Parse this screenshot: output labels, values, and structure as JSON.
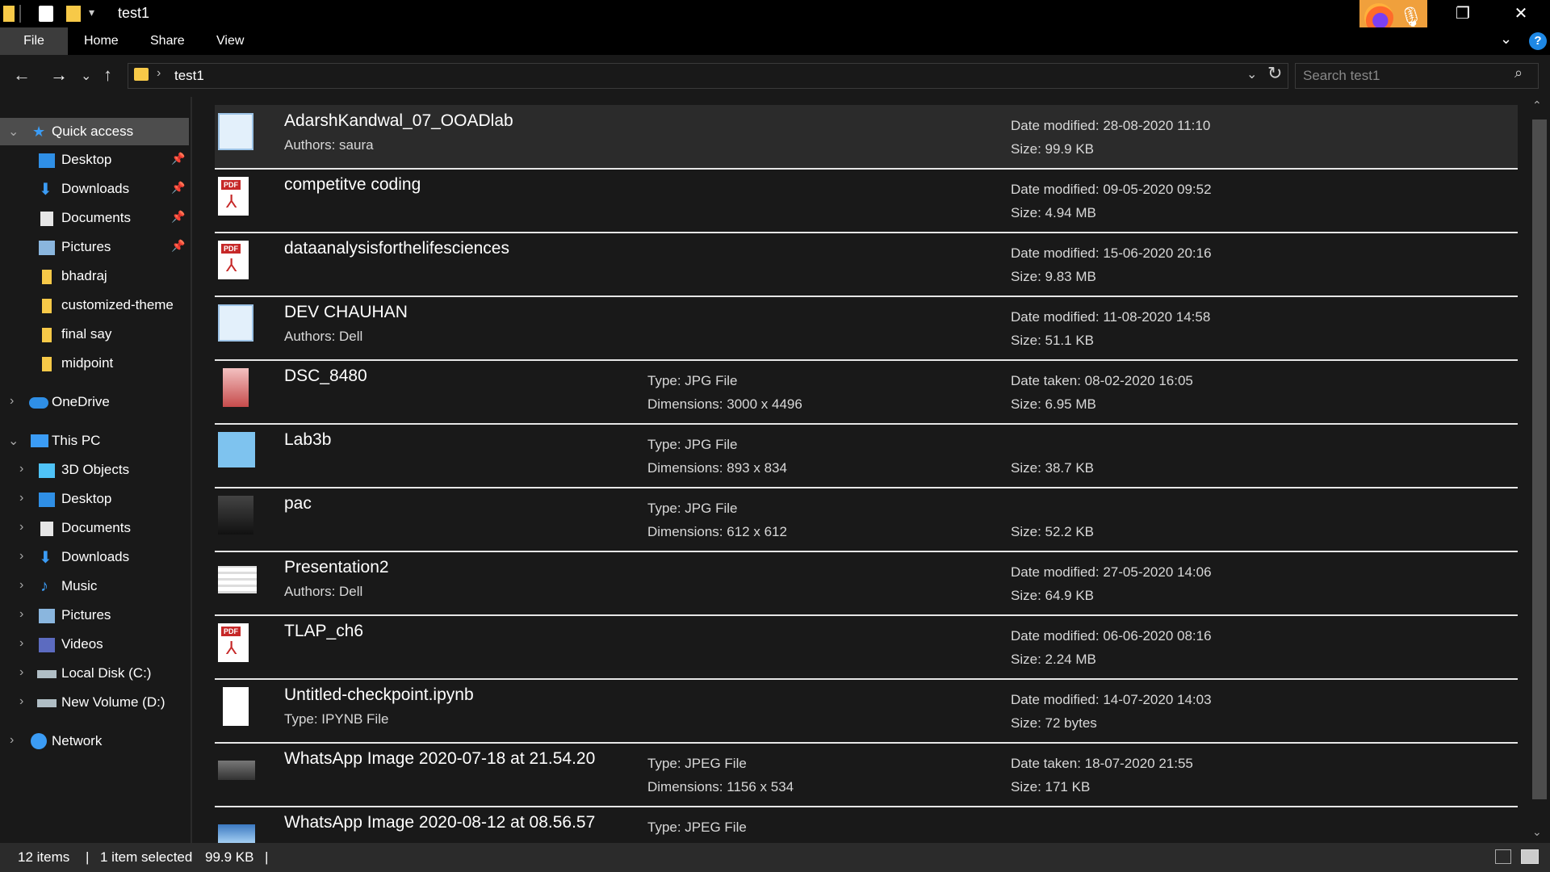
{
  "window": {
    "title": "test1"
  },
  "ribbon": {
    "tabs": [
      "File",
      "Home",
      "Share",
      "View"
    ]
  },
  "address": {
    "path": "test1",
    "search_placeholder": "Search test1"
  },
  "sidebar": {
    "quick_access": "Quick access",
    "quick_items": [
      "Desktop",
      "Downloads",
      "Documents",
      "Pictures",
      "bhadraj",
      "customized-theme",
      "final say",
      "midpoint"
    ],
    "onedrive": "OneDrive",
    "this_pc": "This PC",
    "pc_items": [
      "3D Objects",
      "Desktop",
      "Documents",
      "Downloads",
      "Music",
      "Pictures",
      "Videos",
      "Local Disk (C:)",
      "New Volume (D:)"
    ],
    "network": "Network"
  },
  "files": [
    {
      "name": "AdarshKandwal_07_OOADlab",
      "sub": "Authors: saura",
      "c2a": "",
      "c2b": "",
      "c3a": "Date modified: 28-08-2020 11:10",
      "c3b": "Size: 99.9 KB",
      "icon": "word-doc-icon"
    },
    {
      "name": "competitve coding",
      "sub": "",
      "c2a": "",
      "c2b": "",
      "c3a": "Date modified: 09-05-2020 09:52",
      "c3b": "Size: 4.94 MB",
      "icon": "pdf-icon"
    },
    {
      "name": "dataanalysisforthelifesciences",
      "sub": "",
      "c2a": "",
      "c2b": "",
      "c3a": "Date modified: 15-06-2020 20:16",
      "c3b": "Size: 9.83 MB",
      "icon": "pdf-icon"
    },
    {
      "name": "DEV CHAUHAN",
      "sub": "Authors: Dell",
      "c2a": "",
      "c2b": "",
      "c3a": "Date modified: 11-08-2020 14:58",
      "c3b": "Size: 51.1 KB",
      "icon": "word-doc-icon"
    },
    {
      "name": "DSC_8480",
      "sub": "",
      "c2a": "Type: JPG File",
      "c2b": "Dimensions: 3000 x 4496",
      "c3a": "Date taken: 08-02-2020 16:05",
      "c3b": "Size: 6.95 MB",
      "icon": "photo-thumbnail-icon"
    },
    {
      "name": "Lab3b",
      "sub": "",
      "c2a": "Type: JPG File",
      "c2b": "Dimensions: 893 x 834",
      "c3a": "",
      "c3b": "Size: 38.7 KB",
      "icon": "image-thumbnail-icon"
    },
    {
      "name": "pac",
      "sub": "",
      "c2a": "Type: JPG File",
      "c2b": "Dimensions: 612 x 612",
      "c3a": "",
      "c3b": "Size: 52.2 KB",
      "icon": "photo-thumbnail-icon"
    },
    {
      "name": "Presentation2",
      "sub": "Authors: Dell",
      "c2a": "",
      "c2b": "",
      "c3a": "Date modified: 27-05-2020 14:06",
      "c3b": "Size: 64.9 KB",
      "icon": "presentation-icon"
    },
    {
      "name": "TLAP_ch6",
      "sub": "",
      "c2a": "",
      "c2b": "",
      "c3a": "Date modified: 06-06-2020 08:16",
      "c3b": "Size: 2.24 MB",
      "icon": "pdf-icon"
    },
    {
      "name": "Untitled-checkpoint.ipynb",
      "sub": "Type: IPYNB File",
      "c2a": "",
      "c2b": "",
      "c3a": "Date modified: 14-07-2020 14:03",
      "c3b": "Size: 72 bytes",
      "icon": "blank-file-icon"
    },
    {
      "name": "WhatsApp Image 2020-07-18 at 21.54.20",
      "sub": "",
      "c2a": "Type: JPEG File",
      "c2b": "Dimensions: 1156 x 534",
      "c3a": "Date taken: 18-07-2020 21:55",
      "c3b": "Size: 171 KB",
      "icon": "photo-thumbnail-icon"
    },
    {
      "name": "WhatsApp Image 2020-08-12 at 08.56.57",
      "sub": "",
      "c2a": "Type: JPEG File",
      "c2b": "",
      "c3a": "",
      "c3b": "",
      "icon": "image-thumbnail-icon"
    }
  ],
  "status": {
    "count": "12 items",
    "selected": "1 item selected",
    "size": "99.9 KB"
  },
  "colors": {
    "accent": "#1e88e5",
    "folder": "#f7c948",
    "pdf": "#d32f2f",
    "selection": "#2b2b2b"
  }
}
